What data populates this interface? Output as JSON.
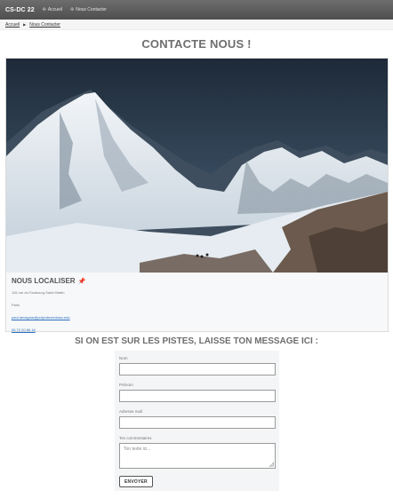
{
  "navbar": {
    "brand": "CS-DC 22",
    "links": [
      {
        "label": "Accueil",
        "icon": "home-icon"
      },
      {
        "label": "Nous Contacter",
        "icon": "contact-icon"
      }
    ]
  },
  "breadcrumb": {
    "items": [
      "Accueil",
      "Nous Contacter"
    ]
  },
  "page": {
    "title": "CONTACTE NOUS !"
  },
  "location": {
    "title": "NOUS LOCALISER",
    "icon": "pin-icon",
    "address": "116 rue du Faubourg Saint Martin",
    "city": "Paris",
    "email": "paul.dexagme@polymtechnician.edu",
    "phone": "06 72 20 86 16"
  },
  "form": {
    "heading": "SI ON EST SUR LES PISTES, LAISSE TON MESSAGE ICI :",
    "fields": [
      {
        "label": "Nom",
        "value": ""
      },
      {
        "label": "Prénom",
        "value": ""
      },
      {
        "label": "Adresse mail",
        "value": ""
      }
    ],
    "comments": {
      "label": "Tes commentaires",
      "placeholder": "Ton texte ici..."
    },
    "submit": "ENVOYER"
  },
  "colors": {
    "navbar": "#5a5a5a",
    "link": "#2a6fbf",
    "title": "#6e6e6e"
  }
}
